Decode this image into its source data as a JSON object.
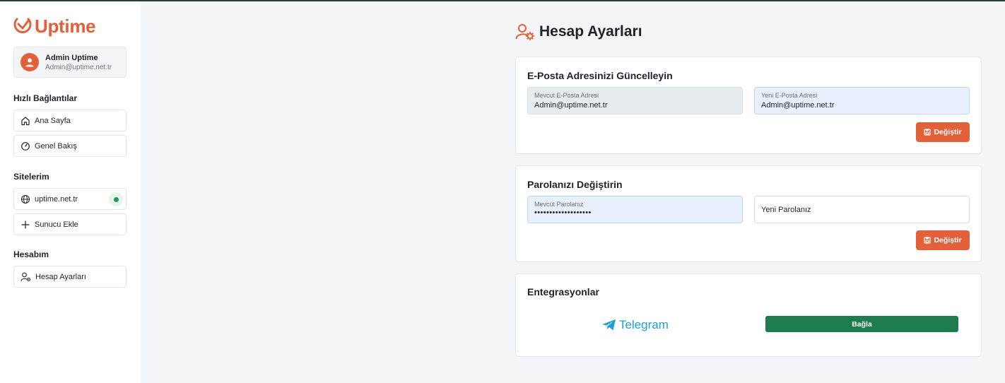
{
  "app": {
    "logo_text": "Uptime",
    "accent_color": "#e2603a",
    "success_color": "#1e7d4e"
  },
  "user": {
    "name": "Admin Uptime",
    "email": "Admin@uptime.net.tr",
    "avatar_icon": "user-icon"
  },
  "sidebar": {
    "quick_links_title": "Hızlı Bağlantılar",
    "quick_links": [
      {
        "label": "Ana Sayfa",
        "icon": "home-icon"
      },
      {
        "label": "Genel Bakış",
        "icon": "gauge-icon"
      }
    ],
    "sites_title": "Sitelerim",
    "sites": [
      {
        "label": "uptime.net.tr",
        "icon": "globe-icon",
        "status": "online"
      }
    ],
    "add_server_label": "Sunucu Ekle",
    "account_title": "Hesabım",
    "account_items": [
      {
        "label": "Hesap Ayarları",
        "icon": "user-gear-icon"
      }
    ]
  },
  "main": {
    "title": "Hesap Ayarları",
    "email_card": {
      "title": "E-Posta Adresinizi Güncelleyin",
      "current_label": "Mevcut E-Posta Adresi",
      "current_value": "Admin@uptime.net.tr",
      "new_label": "Yeni E-Posta Adresi",
      "new_value": "Admin@uptime.net.tr",
      "button_label": "Değiştir"
    },
    "password_card": {
      "title": "Parolanızı Değiştirin",
      "current_label": "Mevcut Parolanız",
      "current_value": "•••••••••••••••••••",
      "new_placeholder": "Yeni Parolanız",
      "button_label": "Değiştir"
    },
    "integrations_card": {
      "title": "Entegrasyonlar",
      "telegram_label": "Telegram",
      "connect_label": "Bağla"
    }
  }
}
